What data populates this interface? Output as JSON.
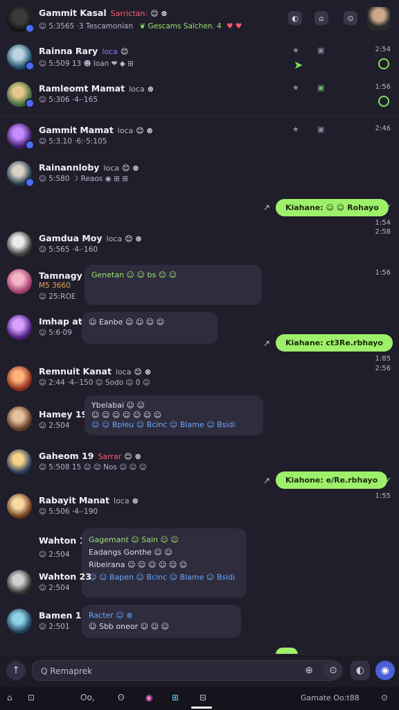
{
  "header": {
    "name": "Gammit Kasal",
    "tag": "Sarrictan:",
    "emojis": "😊 ⊗",
    "sub": "☺ 5:3565 ·3 Tescamonian",
    "sub_badge": "❦ Gescams Salchen. 4",
    "sub_emoji": "♥ ♥"
  },
  "top_icons": [
    "◐",
    "⌂",
    "⊙"
  ],
  "chats": [
    {
      "name": "Rainna Rary",
      "tag": "loca",
      "emoji": "😊",
      "sub": "☺ 5:509 13 ☻ loan ❤ ◆ ⊞",
      "time": "2:54",
      "side": "★",
      "status": "green-dot"
    },
    {
      "name": "Ramleomt Mamat",
      "tag": "loca",
      "emoji": "⊗",
      "sub": "☺ 5:306 ·4-·165",
      "time": "1:56",
      "side": "★",
      "status": "green-dot"
    },
    {
      "name": "Gammit Mamat",
      "tag": "loca",
      "emoji": "😊 ⊗",
      "sub": "☺ 5:3.10 ·6:·5:105",
      "time": "2:46",
      "side": "★"
    },
    {
      "name": "Rainannloby",
      "tag": "loca",
      "emoji": "😊 ⊗",
      "sub": "☺ 5:580 ☽ Reaos ◉ ⊞ ⊞",
      "time": "",
      "side": ""
    }
  ],
  "out_msgs": [
    {
      "text": "Kiahane: ☺ ☺ Rohayo",
      "time": "1:54",
      "time2": "2:58"
    },
    {
      "text": "Kiahane: ct3Re.rbhayo",
      "time": "1:85",
      "time2": "2:56"
    },
    {
      "text": "Kiahone: e/Re.rbhayo",
      "time": "1:55",
      "time2": ""
    }
  ],
  "convo": [
    {
      "name": "Gamdua Moy",
      "tag": "loca",
      "emoji": "😊 ⊗",
      "sub": "☺ 5:565 ·4-·160"
    },
    {
      "name": "Tamnagy 9:",
      "sub1": "M5 3660",
      "sub2": "☺ 25:ROE",
      "bubble": "Genetan ☺ ☺ bs 😊 ☺",
      "time": "1:56"
    },
    {
      "name": "Imhap at",
      "sub": "☺ 5:6·09",
      "bubble": "☺ Eanbe ☺ ☺ ☺ ☺"
    },
    {
      "name": "Remnuit Kanat",
      "tag": "loca",
      "emoji": "😊 ⊗",
      "sub": "☺ 2:44 ·4-·150 ☺ Sodo ☺ 0 ☺"
    },
    {
      "name": "Hamey 19",
      "sub": "☺ 2:504",
      "bubble1": "Ybelabai ☺ ☺",
      "bubble2": "☺ ☺ ☺ ☺ ☺ ☺ ☺",
      "bubble3": "☺ ☺ Bpleu ☺ Bcinc ☺ Blame ☺ Bsidi"
    },
    {
      "name": "Gaheom 19",
      "tag": "Sarrar",
      "emoji": "😊 ⊗",
      "sub": "☺ 5:508 15 ☺ ☺ Nos ☺ ☺ ☺"
    },
    {
      "name": "Rabayit Manat",
      "tag": "loca",
      "emoji": "⊗",
      "sub": "☺ 5:506 ·4-·190"
    },
    {
      "name": "Wahton 13",
      "sub": "☺ 2:504",
      "bubble1": "Gagemant ☺ Sain ☺ ☺",
      "bubble2": "Eadangs Gonthe ☺ ☺",
      "bubble3": "Ribeirana ☺ ☺ ☺ ☺ ☺ ☺",
      "bubble4": "☺ ☺ Bapen ☺ Bcinc ☺ Blame ☺ Bsidi"
    },
    {
      "name": "Wahton 23",
      "sub": "☺ 2:504"
    },
    {
      "name": "Bamen 19",
      "sub": "☺ 2:501",
      "bubble1": "Racter ☺ ⊗",
      "bubble2": "☺ Sbb oneor ☺ ☺ ☺"
    }
  ],
  "composer": {
    "placeholder": "Q Remaprek",
    "left_icon": "↑",
    "right_icons": [
      "⊕",
      "⊙",
      "◐"
    ]
  },
  "tabbar": {
    "items": [
      "⌂",
      "⊡",
      "Oo,",
      "ʘ",
      "◉",
      "⊞",
      "⊟"
    ],
    "right_text": "Gamate Oo:t88",
    "right_icon": "⊙"
  },
  "colors": {
    "accent_green": "#9ef06a",
    "bg": "#201e2b",
    "bubble": "#2e2c3d",
    "tag_red": "#ff5a6e"
  }
}
